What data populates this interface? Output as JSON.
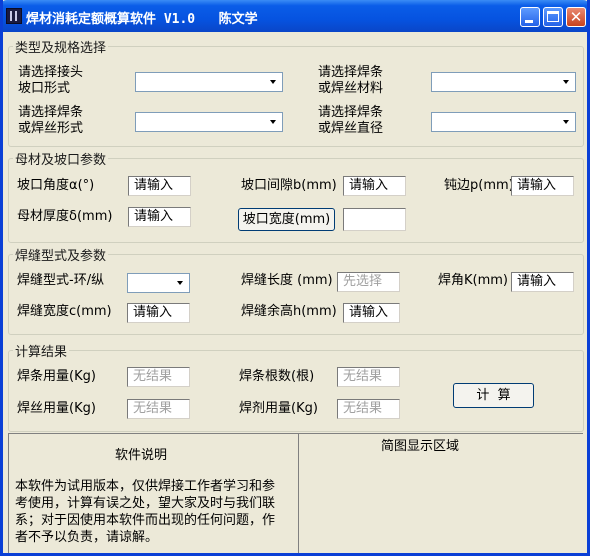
{
  "window": {
    "title": "焊材消耗定额概算软件 V1.0   陈文学"
  },
  "groups": {
    "type": {
      "legend": "类型及规格选择",
      "joint_label_1": "请选择接头",
      "joint_label_2": "坡口形式",
      "material_label_1": "请选择焊条",
      "material_label_2": "或焊丝材料",
      "form_label_1": "请选择焊条",
      "form_label_2": "或焊丝形式",
      "diameter_label_1": "请选择焊条",
      "diameter_label_2": "或焊丝直径"
    },
    "base": {
      "legend": "母材及坡口参数",
      "angle_label": "坡口角度α(°)",
      "angle_value": "请输入",
      "gap_label": "坡口间隙b(mm)",
      "gap_value": "请输入",
      "blunt_label": "钝边p(mm)",
      "blunt_value": "请输入",
      "thickness_label": "母材厚度δ(mm)",
      "thickness_value": "请输入",
      "width_button": "坡口宽度(mm)",
      "width_value": ""
    },
    "weld": {
      "legend": "焊缝型式及参数",
      "type_label": "焊缝型式-环/纵",
      "length_label": "焊缝长度 (mm)",
      "length_value": "先选择",
      "leg_label": "焊角K(mm)",
      "leg_value": "请输入",
      "width_label": "焊缝宽度c(mm)",
      "width_value": "请输入",
      "reinforce_label": "焊缝余高h(mm)",
      "reinforce_value": "请输入"
    },
    "result": {
      "legend": "计算结果",
      "electrode_label": "焊条用量(Kg)",
      "electrode_value": "无结果",
      "count_label": "焊条根数(根)",
      "count_value": "无结果",
      "wire_label": "焊丝用量(Kg)",
      "wire_value": "无结果",
      "flux_label": "焊剂用量(Kg)",
      "flux_value": "无结果",
      "calc_button": "计  算"
    }
  },
  "info": {
    "title": "软件说明",
    "text": "本软件为试用版本，仅供焊接工作者学习和参考使用，计算有误之处，望大家及时与我们联系；对于因使用本软件而出现的任何问题，作者不予以负责，请谅解。"
  },
  "preview": {
    "title": "简图显示区域"
  },
  "colors": {
    "title_bar": "#0653e0",
    "window_bg": "#ece9d8",
    "close_button": "#c8431f",
    "disabled_text": "#a0a0a0"
  }
}
